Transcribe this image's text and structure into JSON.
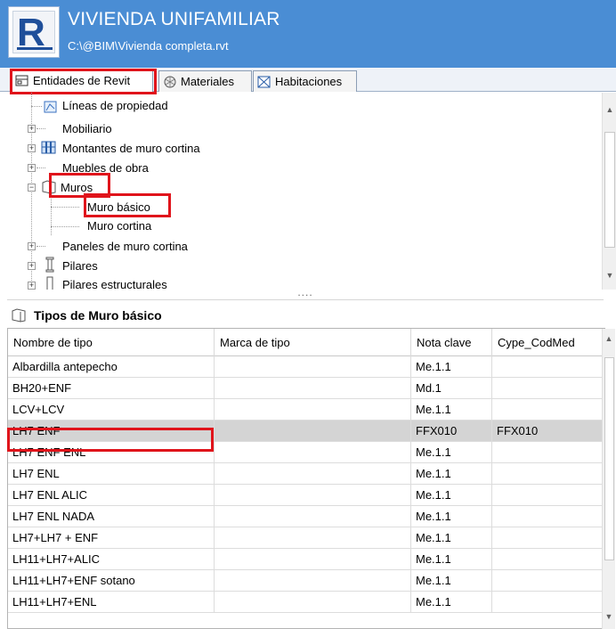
{
  "header": {
    "title": "VIVIENDA UNIFAMILIAR",
    "path": "C:\\@BIM\\Vivienda completa.rvt",
    "logo_icon": "revit-logo-icon",
    "bg_color": "#4a8dd4"
  },
  "tabs": [
    {
      "label": "Entidades de Revit",
      "icon": "entities-icon",
      "active": true
    },
    {
      "label": "Materiales",
      "icon": "materials-icon",
      "active": false
    },
    {
      "label": "Habitaciones",
      "icon": "rooms-icon",
      "active": false
    }
  ],
  "tree": {
    "items": [
      {
        "label": "Líneas de propiedad",
        "icon": "property-line-icon",
        "expander": ""
      },
      {
        "label": "Mobiliario",
        "icon": "",
        "expander": "+"
      },
      {
        "label": "Montantes de muro cortina",
        "icon": "mullion-icon",
        "expander": "+"
      },
      {
        "label": "Muebles de obra",
        "icon": "",
        "expander": "+"
      },
      {
        "label": "Muros",
        "icon": "wall-icon",
        "expander": "−"
      },
      {
        "label": "Muro básico",
        "icon": "",
        "expander": ""
      },
      {
        "label": "Muro cortina",
        "icon": "",
        "expander": ""
      },
      {
        "label": "Paneles de muro cortina",
        "icon": "",
        "expander": "+"
      },
      {
        "label": "Pilares",
        "icon": "column-icon",
        "expander": "+"
      },
      {
        "label": "Pilares estructurales",
        "icon": "structural-column-icon",
        "expander": "+"
      }
    ],
    "splitter_grip": "...."
  },
  "section": {
    "title": "Tipos de Muro básico",
    "icon": "wall-type-icon"
  },
  "table": {
    "columns": [
      "Nombre de tipo",
      "Marca de tipo",
      "Nota clave",
      "Cype_CodMed"
    ],
    "rows": [
      [
        "Albardilla antepecho",
        "",
        "Me.1.1",
        ""
      ],
      [
        "BH20+ENF",
        "",
        "Md.1",
        ""
      ],
      [
        "LCV+LCV",
        "",
        "Me.1.1",
        ""
      ],
      [
        "LH7 ENF",
        "",
        "FFX010",
        "FFX010"
      ],
      [
        "LH7 ENF ENL",
        "",
        "Me.1.1",
        ""
      ],
      [
        "LH7 ENL",
        "",
        "Me.1.1",
        ""
      ],
      [
        "LH7 ENL ALIC",
        "",
        "Me.1.1",
        ""
      ],
      [
        "LH7 ENL NADA",
        "",
        "Me.1.1",
        ""
      ],
      [
        "LH7+LH7 + ENF",
        "",
        "Me.1.1",
        ""
      ],
      [
        "LH11+LH7+ALIC",
        "",
        "Me.1.1",
        ""
      ],
      [
        "LH11+LH7+ENF sotano",
        "",
        "Me.1.1",
        ""
      ],
      [
        "LH11+LH7+ENL",
        "",
        "Me.1.1",
        ""
      ]
    ],
    "selected_row": 3
  },
  "colors": {
    "highlight": "#e0141b",
    "selected_row": "#d4d4d4"
  }
}
